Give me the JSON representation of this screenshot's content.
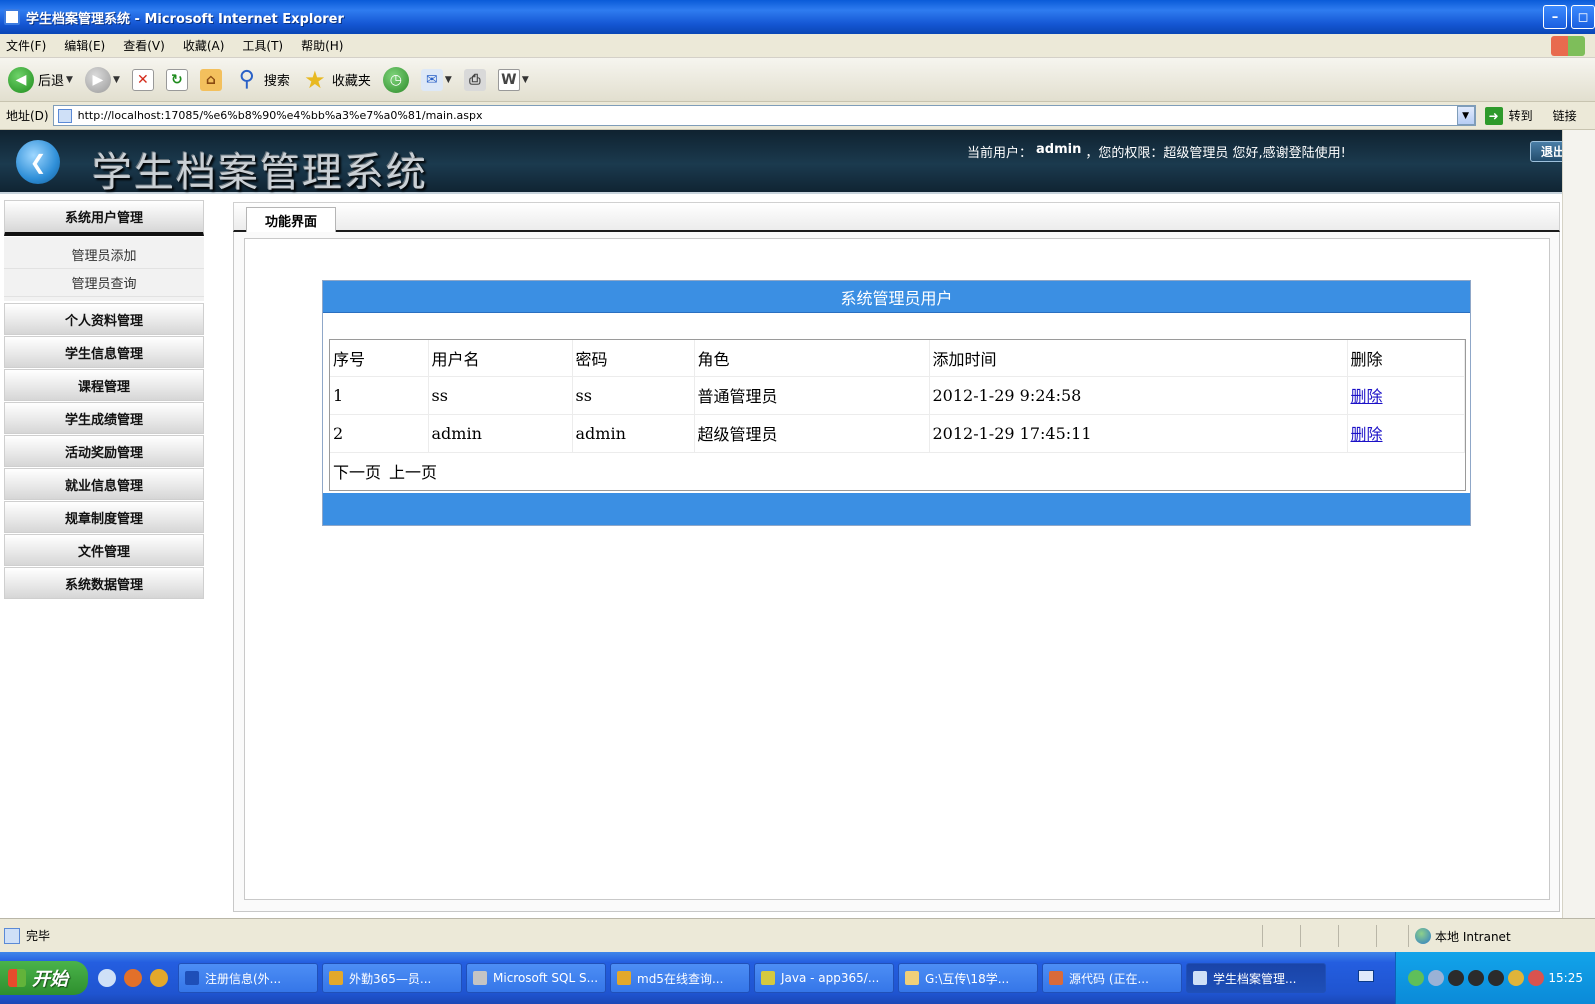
{
  "window": {
    "title": "学生档案管理系统 - Microsoft Internet Explorer"
  },
  "menubar": {
    "items": [
      "文件(F)",
      "编辑(E)",
      "查看(V)",
      "收藏(A)",
      "工具(T)",
      "帮助(H)"
    ]
  },
  "toolbar": {
    "back_label": "后退",
    "search_label": "搜索",
    "favorites_label": "收藏夹"
  },
  "addressbar": {
    "label": "地址(D)",
    "url": "http://localhost:17085/%e6%b8%90%e4%bb%a3%e7%a0%81/main.aspx",
    "go_label": "转到",
    "links_label": "链接"
  },
  "banner": {
    "title": "学生档案管理系统",
    "current_user_prefix": "当前用户：",
    "username": "admin",
    "permission_text": "，您的权限：超级管理员  您好,感谢登陆使用!",
    "logout_label": "退出"
  },
  "sidebar": {
    "sections": [
      {
        "label": "系统用户管理",
        "items": [
          "管理员添加",
          "管理员查询"
        ]
      },
      {
        "label": "个人资料管理"
      },
      {
        "label": "学生信息管理"
      },
      {
        "label": "课程管理"
      },
      {
        "label": "学生成绩管理"
      },
      {
        "label": "活动奖励管理"
      },
      {
        "label": "就业信息管理"
      },
      {
        "label": "规章制度管理"
      },
      {
        "label": "文件管理"
      },
      {
        "label": "系统数据管理"
      }
    ]
  },
  "content": {
    "tab_label": "功能界面",
    "panel_title": "系统管理员用户",
    "columns": [
      "序号",
      "用户名",
      "密码",
      "角色",
      "添加时间",
      "删除"
    ],
    "rows": [
      {
        "no": "1",
        "username": "ss",
        "password": "ss",
        "role": "普通管理员",
        "added": "2012-1-29 9:24:58",
        "delete": "删除"
      },
      {
        "no": "2",
        "username": "admin",
        "password": "admin",
        "role": "超级管理员",
        "added": "2012-1-29 17:45:11",
        "delete": "删除"
      }
    ],
    "pager": {
      "next": "下一页",
      "prev": "上一页"
    }
  },
  "statusbar": {
    "status": "完毕",
    "zone": "本地 Intranet"
  },
  "taskbar": {
    "start_label": "开始",
    "tasks": [
      {
        "label": "注册信息(外...",
        "icon_color": "#1e4fb8"
      },
      {
        "label": "外勤365—员...",
        "icon_color": "#e3a82b"
      },
      {
        "label": "Microsoft SQL S...",
        "icon_color": "#c4c4c4"
      },
      {
        "label": "md5在线查询...",
        "icon_color": "#e3a82b"
      },
      {
        "label": "Java - app365/...",
        "icon_color": "#d6c93e"
      },
      {
        "label": "G:\\互传\\18学...",
        "icon_color": "#f0d07a"
      },
      {
        "label": "源代码 (正在...",
        "icon_color": "#d96a3a"
      },
      {
        "label": "学生档案管理...",
        "icon_color": "#cfe0f7",
        "active": true
      }
    ],
    "clock": "15:25"
  }
}
